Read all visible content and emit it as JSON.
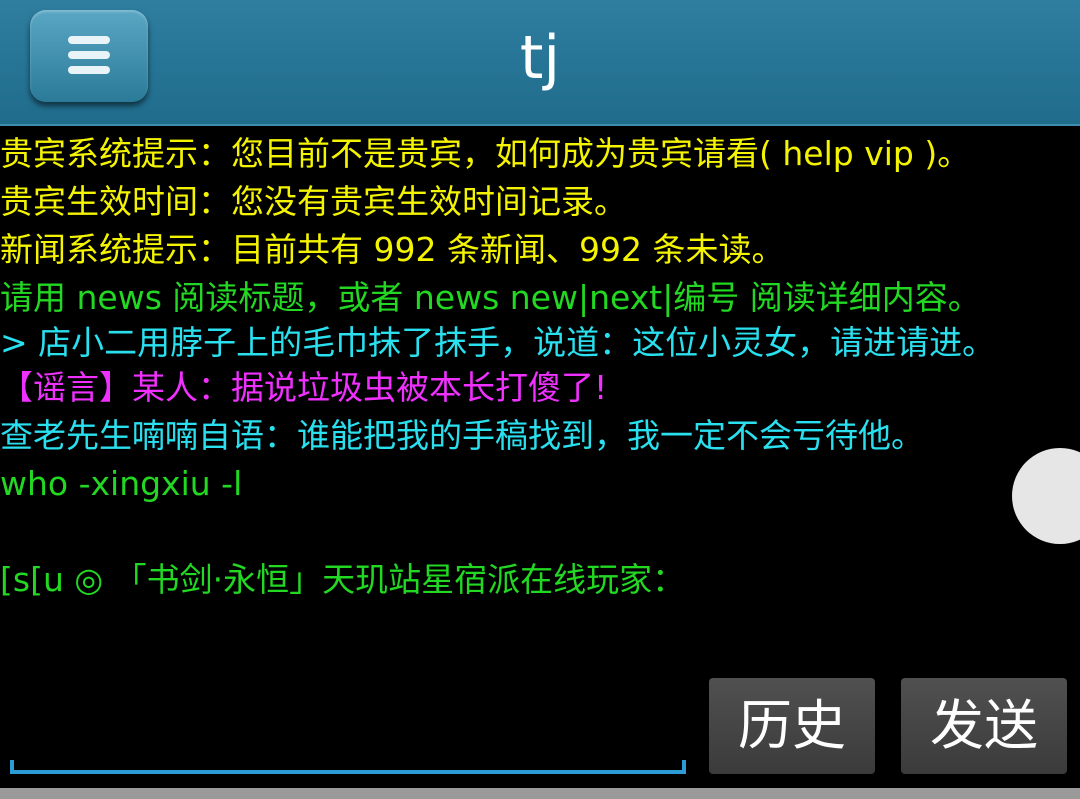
{
  "header": {
    "title": "tj",
    "menu_icon": "hamburger-menu-icon"
  },
  "console": {
    "lines": [
      {
        "text": "贵宾系统提示：您目前不是贵宾，如何成为贵宾请看( help vip )。",
        "color": "#f4f400"
      },
      {
        "text": "贵宾生效时间：您没有贵宾生效时间记录。",
        "color": "#f4f400"
      },
      {
        "text": "新闻系统提示：目前共有 992 条新闻、992 条未读。",
        "color": "#f4f400"
      },
      {
        "text": "请用 news 阅读标题，或者 news new|next|编号 阅读详细内容。",
        "color": "#22d822"
      },
      {
        "text": "> 店小二用脖子上的毛巾抹了抹手，说道：这位小灵女，请进请进。",
        "color": "#2ae0ef"
      },
      {
        "text": "【谣言】某人：据说垃圾虫被本长打傻了!",
        "color": "#f030ff"
      },
      {
        "text": "查老先生喃喃自语：谁能把我的手稿找到，我一定不会亏待他。",
        "color": "#2ae0ef"
      },
      {
        "text": "who -xingxiu -l",
        "color": "#22d822"
      },
      {
        "text": "[s[u ◎ 「书剑·永恒」天玑站星宿派在线玩家：",
        "color": "#22d822"
      }
    ]
  },
  "input": {
    "value": "",
    "placeholder": ""
  },
  "buttons": {
    "history_label": "历史",
    "send_label": "发送"
  }
}
